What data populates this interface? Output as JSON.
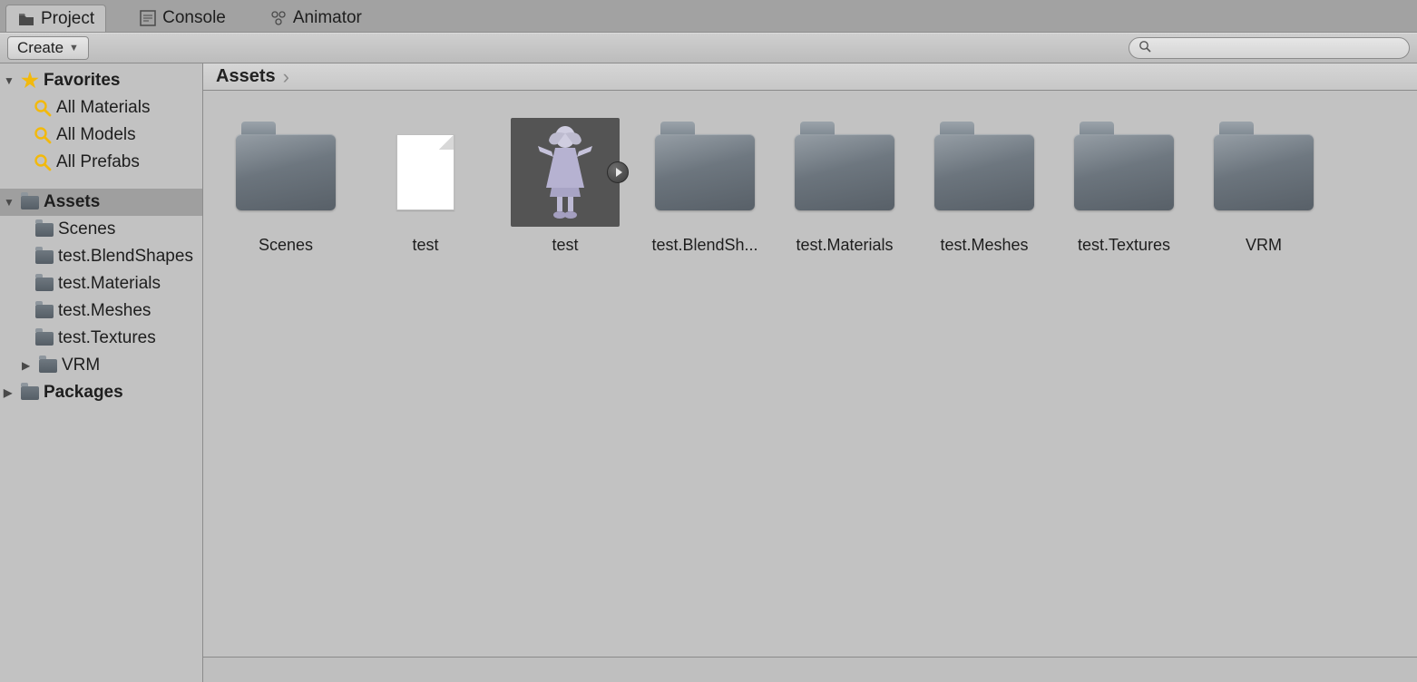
{
  "tabs": {
    "project": "Project",
    "console": "Console",
    "animator": "Animator"
  },
  "toolbar": {
    "create_label": "Create",
    "search_placeholder": ""
  },
  "sidebar": {
    "favorites": {
      "label": "Favorites",
      "items": [
        {
          "label": "All Materials"
        },
        {
          "label": "All Models"
        },
        {
          "label": "All Prefabs"
        }
      ]
    },
    "assets": {
      "label": "Assets",
      "children": [
        {
          "label": "Scenes"
        },
        {
          "label": "test.BlendShapes"
        },
        {
          "label": "test.Materials"
        },
        {
          "label": "test.Meshes"
        },
        {
          "label": "test.Textures"
        },
        {
          "label": "VRM",
          "expandable": true
        }
      ]
    },
    "packages": {
      "label": "Packages"
    }
  },
  "breadcrumb": {
    "root": "Assets"
  },
  "grid": {
    "items": [
      {
        "name": "Scenes",
        "type": "folder"
      },
      {
        "name": "test",
        "type": "file"
      },
      {
        "name": "test",
        "type": "prefab",
        "selected": true
      },
      {
        "name": "test.BlendSh...",
        "type": "folder"
      },
      {
        "name": "test.Materials",
        "type": "folder"
      },
      {
        "name": "test.Meshes",
        "type": "folder"
      },
      {
        "name": "test.Textures",
        "type": "folder"
      },
      {
        "name": "VRM",
        "type": "folder"
      }
    ]
  }
}
